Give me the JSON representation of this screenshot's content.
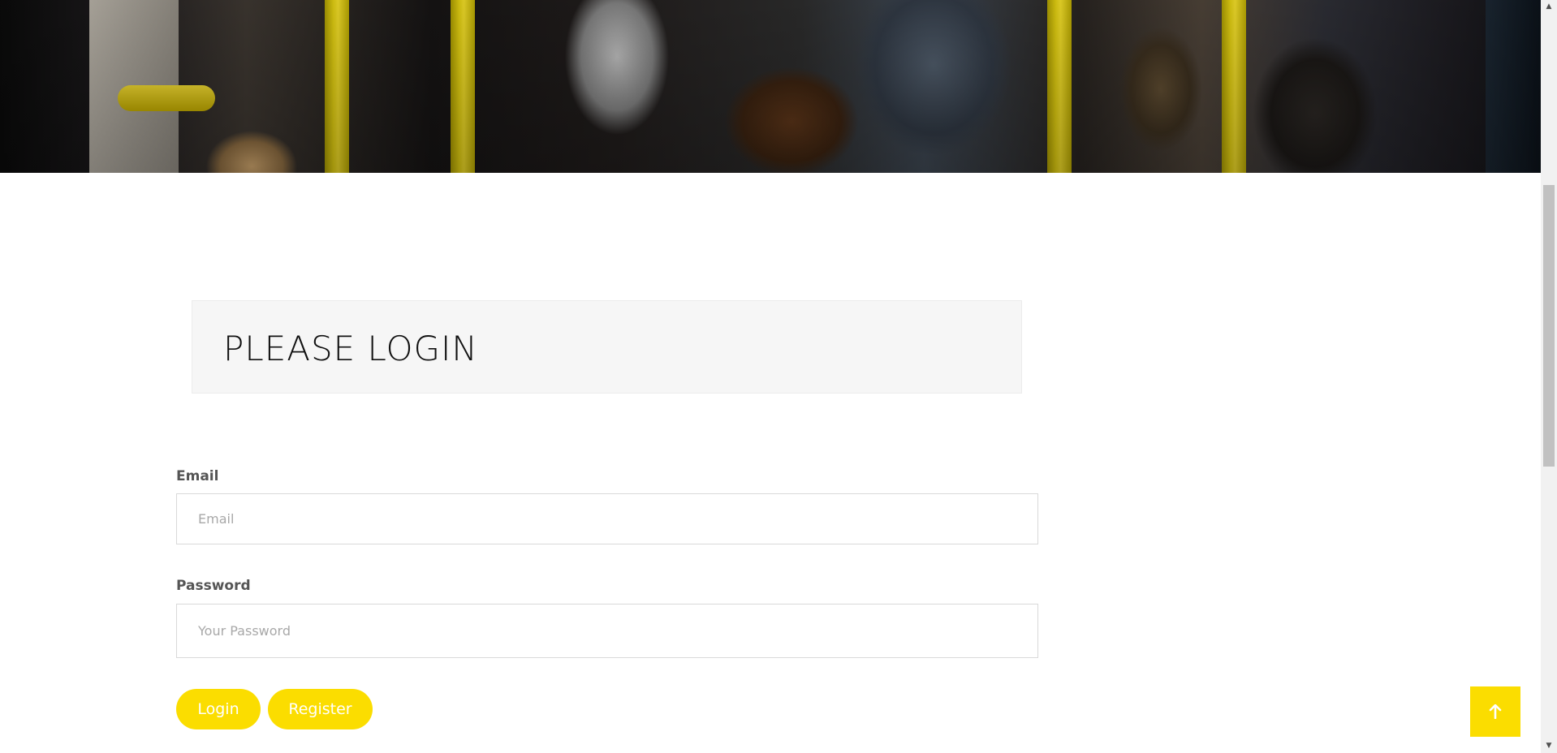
{
  "hero": {
    "image_description": "Crowded subway train interior with yellow grab poles"
  },
  "login": {
    "title": "PLEASE LOGIN",
    "email": {
      "label": "Email",
      "placeholder": "Email",
      "value": ""
    },
    "password": {
      "label": "Password",
      "placeholder": "Your Password",
      "value": ""
    },
    "login_button": "Login",
    "register_button": "Register"
  },
  "colors": {
    "accent": "#fbdd00",
    "heading_bg": "#f6f6f6",
    "label_text": "#555555"
  },
  "icons": {
    "back_to_top": "arrow-up-icon",
    "scroll_up": "triangle-up-icon",
    "scroll_down": "triangle-down-icon"
  }
}
